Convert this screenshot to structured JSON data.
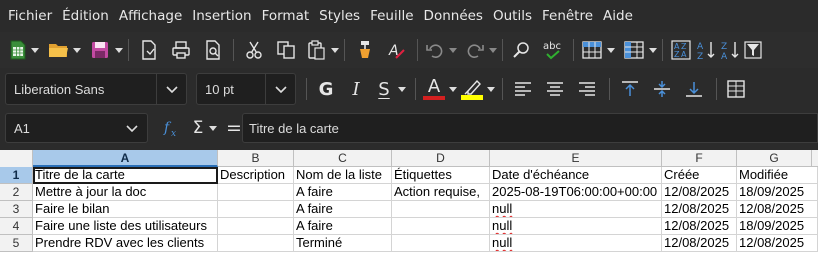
{
  "menu": [
    "Fichier",
    "Édition",
    "Affichage",
    "Insertion",
    "Format",
    "Styles",
    "Feuille",
    "Données",
    "Outils",
    "Fenêtre",
    "Aide"
  ],
  "toolbar_icons": [
    "new-spreadsheet-icon",
    "open-folder-icon",
    "save-icon",
    "export-pdf-icon",
    "print-icon",
    "print-preview-icon",
    "cut-icon",
    "copy-icon",
    "paste-icon",
    "clone-formatting-icon",
    "clear-formatting-icon",
    "undo-icon",
    "redo-icon",
    "find-replace-icon",
    "spelling-icon",
    "row-icon",
    "column-icon",
    "sort-icon",
    "sort-ascending-icon",
    "sort-descending-icon",
    "autofilter-icon"
  ],
  "format": {
    "font_name": "Liberation Sans",
    "font_size": "10 pt",
    "bold_glyph": "G",
    "italic_glyph": "I",
    "underline_glyph": "S",
    "font_color_glyph": "A",
    "font_color": "#d42020",
    "highlight_color": "#ffff00"
  },
  "formula_bar": {
    "name_box": "A1",
    "sum_glyph": "Σ",
    "equals_glyph": "=",
    "content": "Titre de la carte"
  },
  "sheet": {
    "columns": [
      "A",
      "B",
      "C",
      "D",
      "E",
      "F",
      "G"
    ],
    "row_numbers": [
      "1",
      "2",
      "3",
      "4",
      "5"
    ],
    "rows": [
      [
        "Titre de la carte",
        "Description",
        "Nom de la liste",
        "Étiquettes",
        "Date d'échéance",
        "Créée",
        "Modifiée"
      ],
      [
        "Mettre à jour la doc",
        "",
        "A faire",
        "Action requise,",
        "2025-08-19T06:00:00+00:00",
        "12/08/2025",
        "18/09/2025"
      ],
      [
        "Faire le bilan",
        "",
        "A faire",
        "",
        "null",
        "12/08/2025",
        "12/08/2025"
      ],
      [
        "Faire une liste des utilisateurs",
        "",
        "A faire",
        "",
        "null",
        "12/08/2025",
        "18/09/2025"
      ],
      [
        "Prendre RDV avec les clients",
        "",
        "Terminé",
        "",
        "null",
        "12/08/2025",
        "12/08/2025"
      ]
    ],
    "selected_cell": "A1",
    "accent_color": "#a8c9ea"
  }
}
